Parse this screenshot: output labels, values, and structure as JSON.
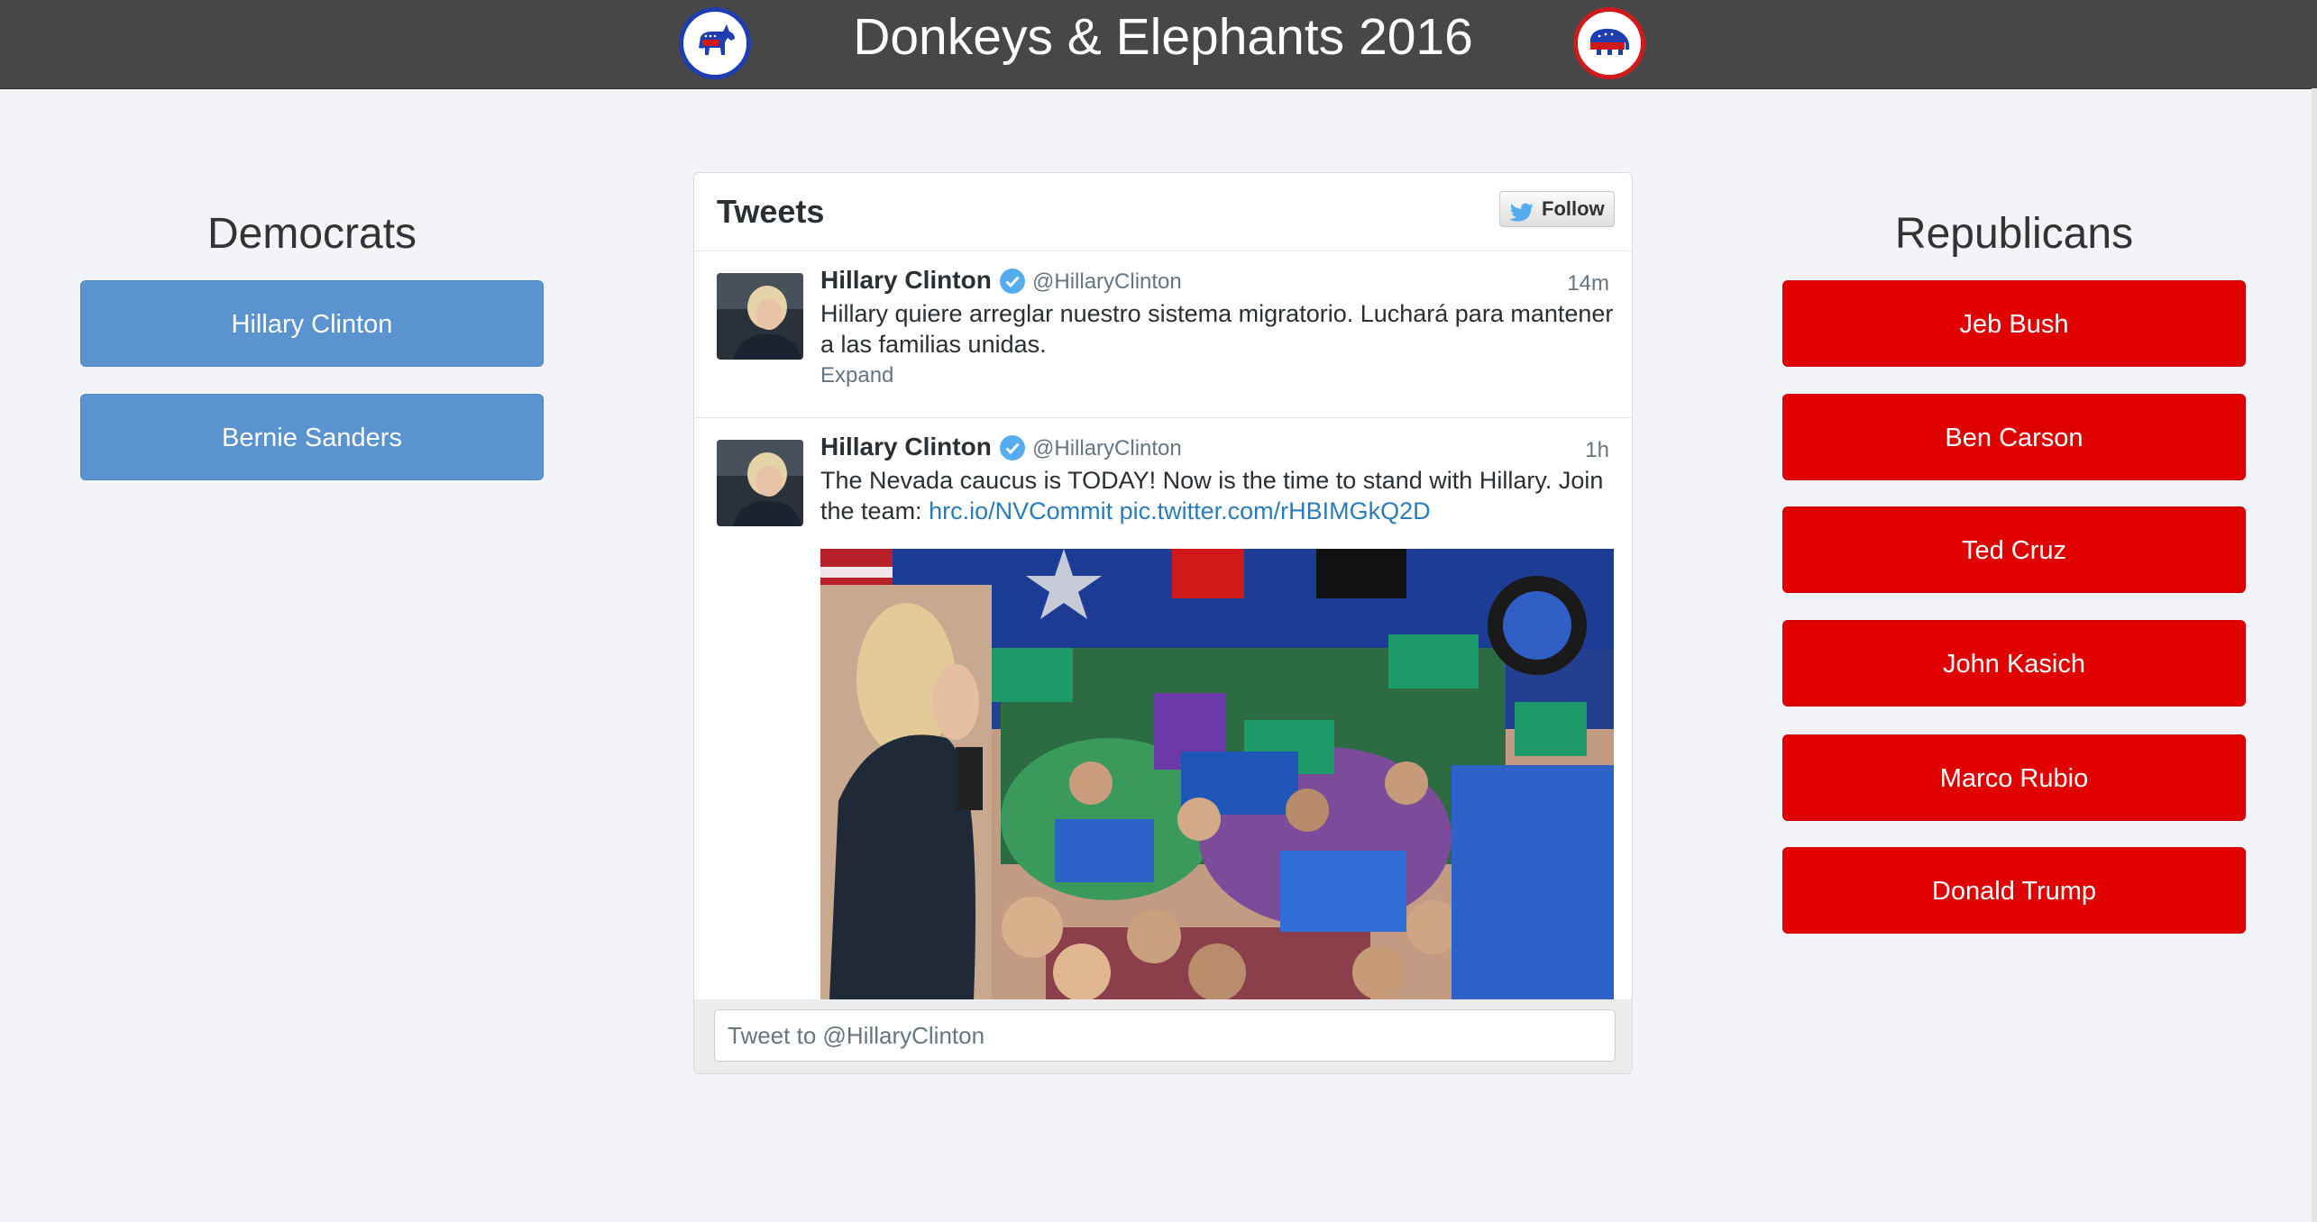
{
  "header": {
    "title": "Donkeys & Elephants 2016",
    "left_logo_icon": "democratic-donkey-icon",
    "right_logo_icon": "republican-elephant-icon"
  },
  "democrats": {
    "heading": "Democrats",
    "candidates": [
      "Hillary Clinton",
      "Bernie Sanders"
    ],
    "button_color": "#5a93cf"
  },
  "republicans": {
    "heading": "Republicans",
    "candidates": [
      "Jeb Bush",
      "Ben Carson",
      "Ted Cruz",
      "John Kasich",
      "Marco Rubio",
      "Donald Trump"
    ],
    "button_color": "#e00000"
  },
  "twitter": {
    "title": "Tweets",
    "follow_label": "Follow",
    "tweets": [
      {
        "name": "Hillary Clinton",
        "handle": "@HillaryClinton",
        "time": "14m",
        "text": "Hillary quiere arreglar nuestro sistema migratorio. Luchará para mantener a las familias unidas.",
        "action": "Expand"
      },
      {
        "name": "Hillary Clinton",
        "handle": "@HillaryClinton",
        "time": "1h",
        "text": "The Nevada caucus is TODAY! Now is the time to stand with Hillary. Join the team:",
        "link1": "hrc.io/NVCommit",
        "link2": "pic.twitter.com/rHBIMGkQ2D"
      }
    ],
    "composer_placeholder": "Tweet to @HillaryClinton",
    "link_color": "#2b7bb9"
  }
}
